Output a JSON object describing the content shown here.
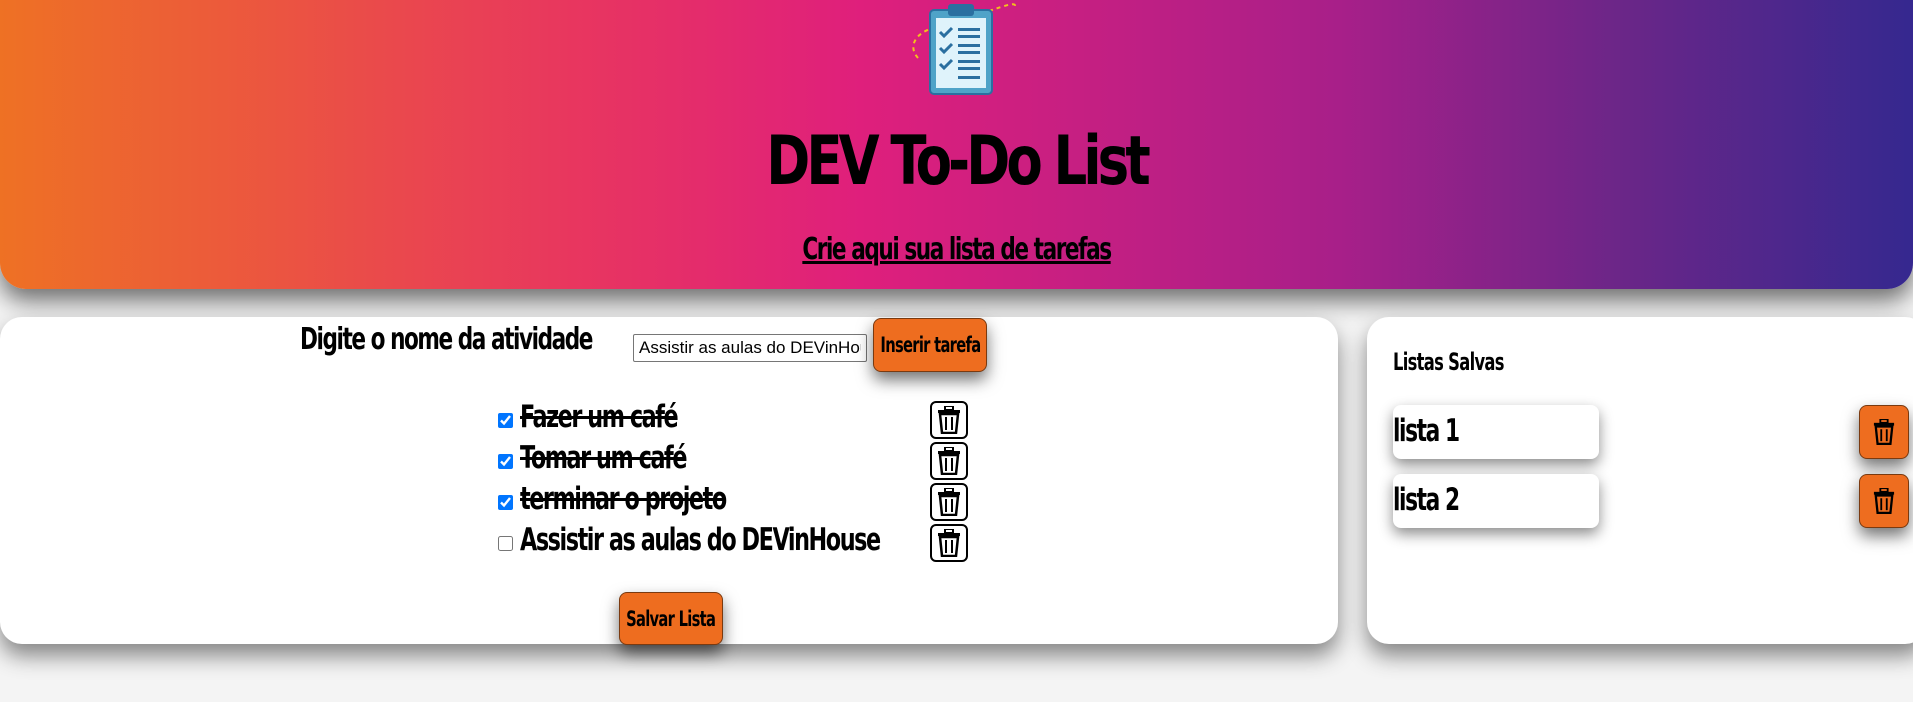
{
  "header": {
    "title": "DEV To-Do List",
    "subtitle": "Crie aqui sua lista de tarefas",
    "gradient_colors": [
      "#ee7124",
      "#e8365f",
      "#df1f7c",
      "#a81f89",
      "#6a2688",
      "#35288f"
    ],
    "logo_icon": "clipboard-checklist-icon"
  },
  "form": {
    "label": "Digite o nome da atividade",
    "input_value": "Assistir as aulas do DEVinHouse",
    "insert_button": "Inserir tarefa"
  },
  "tasks": [
    {
      "label": "Fazer um café",
      "done": true
    },
    {
      "label": "Tomar um café",
      "done": true
    },
    {
      "label": "terminar o projeto",
      "done": true
    },
    {
      "label": "Assistir as aulas do DEVinHouse",
      "done": false
    }
  ],
  "save_button": "Salvar Lista",
  "saved": {
    "title": "Listas Salvas",
    "lists": [
      {
        "label": "lista 1"
      },
      {
        "label": "lista 2"
      }
    ]
  },
  "colors": {
    "accent": "#ee6d1f",
    "panel": "#ffffff",
    "background": "#f4f4f4"
  },
  "icons": {
    "delete": "trash-icon"
  }
}
